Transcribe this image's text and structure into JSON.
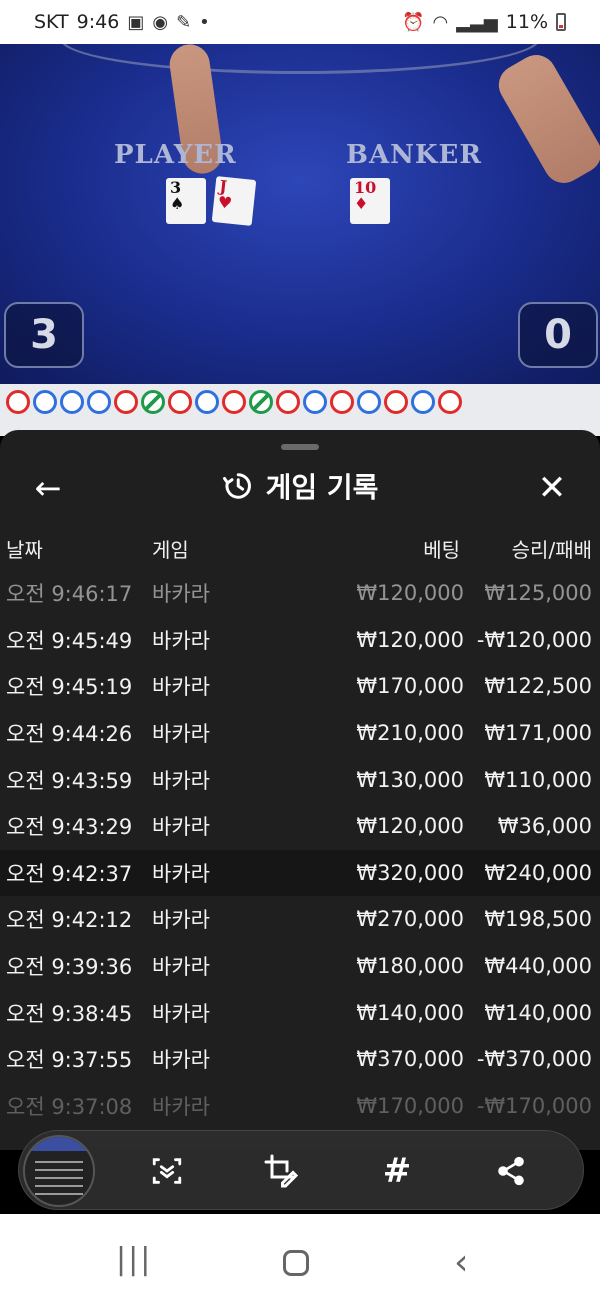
{
  "status_bar": {
    "carrier": "SKT",
    "time": "9:46",
    "battery": "11%",
    "icons": [
      "gallery-icon",
      "avatar-icon",
      "pen-icon",
      "dot-icon",
      "alarm-icon",
      "wifi-icon",
      "signal-icon",
      "battery-icon"
    ]
  },
  "game_view": {
    "player_label": "PLAYER",
    "banker_label": "BANKER",
    "player_cards": [
      {
        "rank": "3",
        "suit": "♠",
        "color": "#111111"
      },
      {
        "rank": "J",
        "suit": "♥",
        "color": "#c8102e"
      }
    ],
    "banker_cards": [
      {
        "rank": "10",
        "suit": "♦",
        "color": "#c8102e"
      }
    ],
    "player_score": "3",
    "banker_score": "0"
  },
  "roadmap": {
    "beads": [
      "red",
      "blue",
      "blue",
      "blue",
      "red",
      "green",
      "red",
      "blue",
      "red",
      "green",
      "red",
      "blue",
      "red",
      "blue",
      "red",
      "blue",
      "red"
    ]
  },
  "sheet": {
    "title": "게임 기록",
    "columns": {
      "date": "날짜",
      "game": "게임",
      "bet": "베팅",
      "result": "승리/패배"
    },
    "rows": [
      {
        "date": "오전 9:46:17",
        "game": "바카라",
        "bet": "₩120,000",
        "result": "₩125,000"
      },
      {
        "date": "오전 9:45:49",
        "game": "바카라",
        "bet": "₩120,000",
        "result": "-₩120,000"
      },
      {
        "date": "오전 9:45:19",
        "game": "바카라",
        "bet": "₩170,000",
        "result": "₩122,500"
      },
      {
        "date": "오전 9:44:26",
        "game": "바카라",
        "bet": "₩210,000",
        "result": "₩171,000"
      },
      {
        "date": "오전 9:43:59",
        "game": "바카라",
        "bet": "₩130,000",
        "result": "₩110,000"
      },
      {
        "date": "오전 9:43:29",
        "game": "바카라",
        "bet": "₩120,000",
        "result": "₩36,000"
      },
      {
        "date": "오전 9:42:37",
        "game": "바카라",
        "bet": "₩320,000",
        "result": "₩240,000"
      },
      {
        "date": "오전 9:42:12",
        "game": "바카라",
        "bet": "₩270,000",
        "result": "₩198,500"
      },
      {
        "date": "오전 9:39:36",
        "game": "바카라",
        "bet": "₩180,000",
        "result": "₩440,000"
      },
      {
        "date": "오전 9:38:45",
        "game": "바카라",
        "bet": "₩140,000",
        "result": "₩140,000"
      },
      {
        "date": "오전 9:37:55",
        "game": "바카라",
        "bet": "₩370,000",
        "result": "-₩370,000"
      },
      {
        "date": "오전 9:37:08",
        "game": "바카라",
        "bet": "₩170,000",
        "result": "-₩170,000"
      }
    ]
  },
  "toolbar": {
    "hashtag": "#"
  },
  "colors": {
    "sheet_bg": "#1f1f1f",
    "felt": "#1a2c8c",
    "banker_red": "#e12a2a",
    "player_blue": "#2f6fe0",
    "tie_green": "#1f9a4a"
  }
}
